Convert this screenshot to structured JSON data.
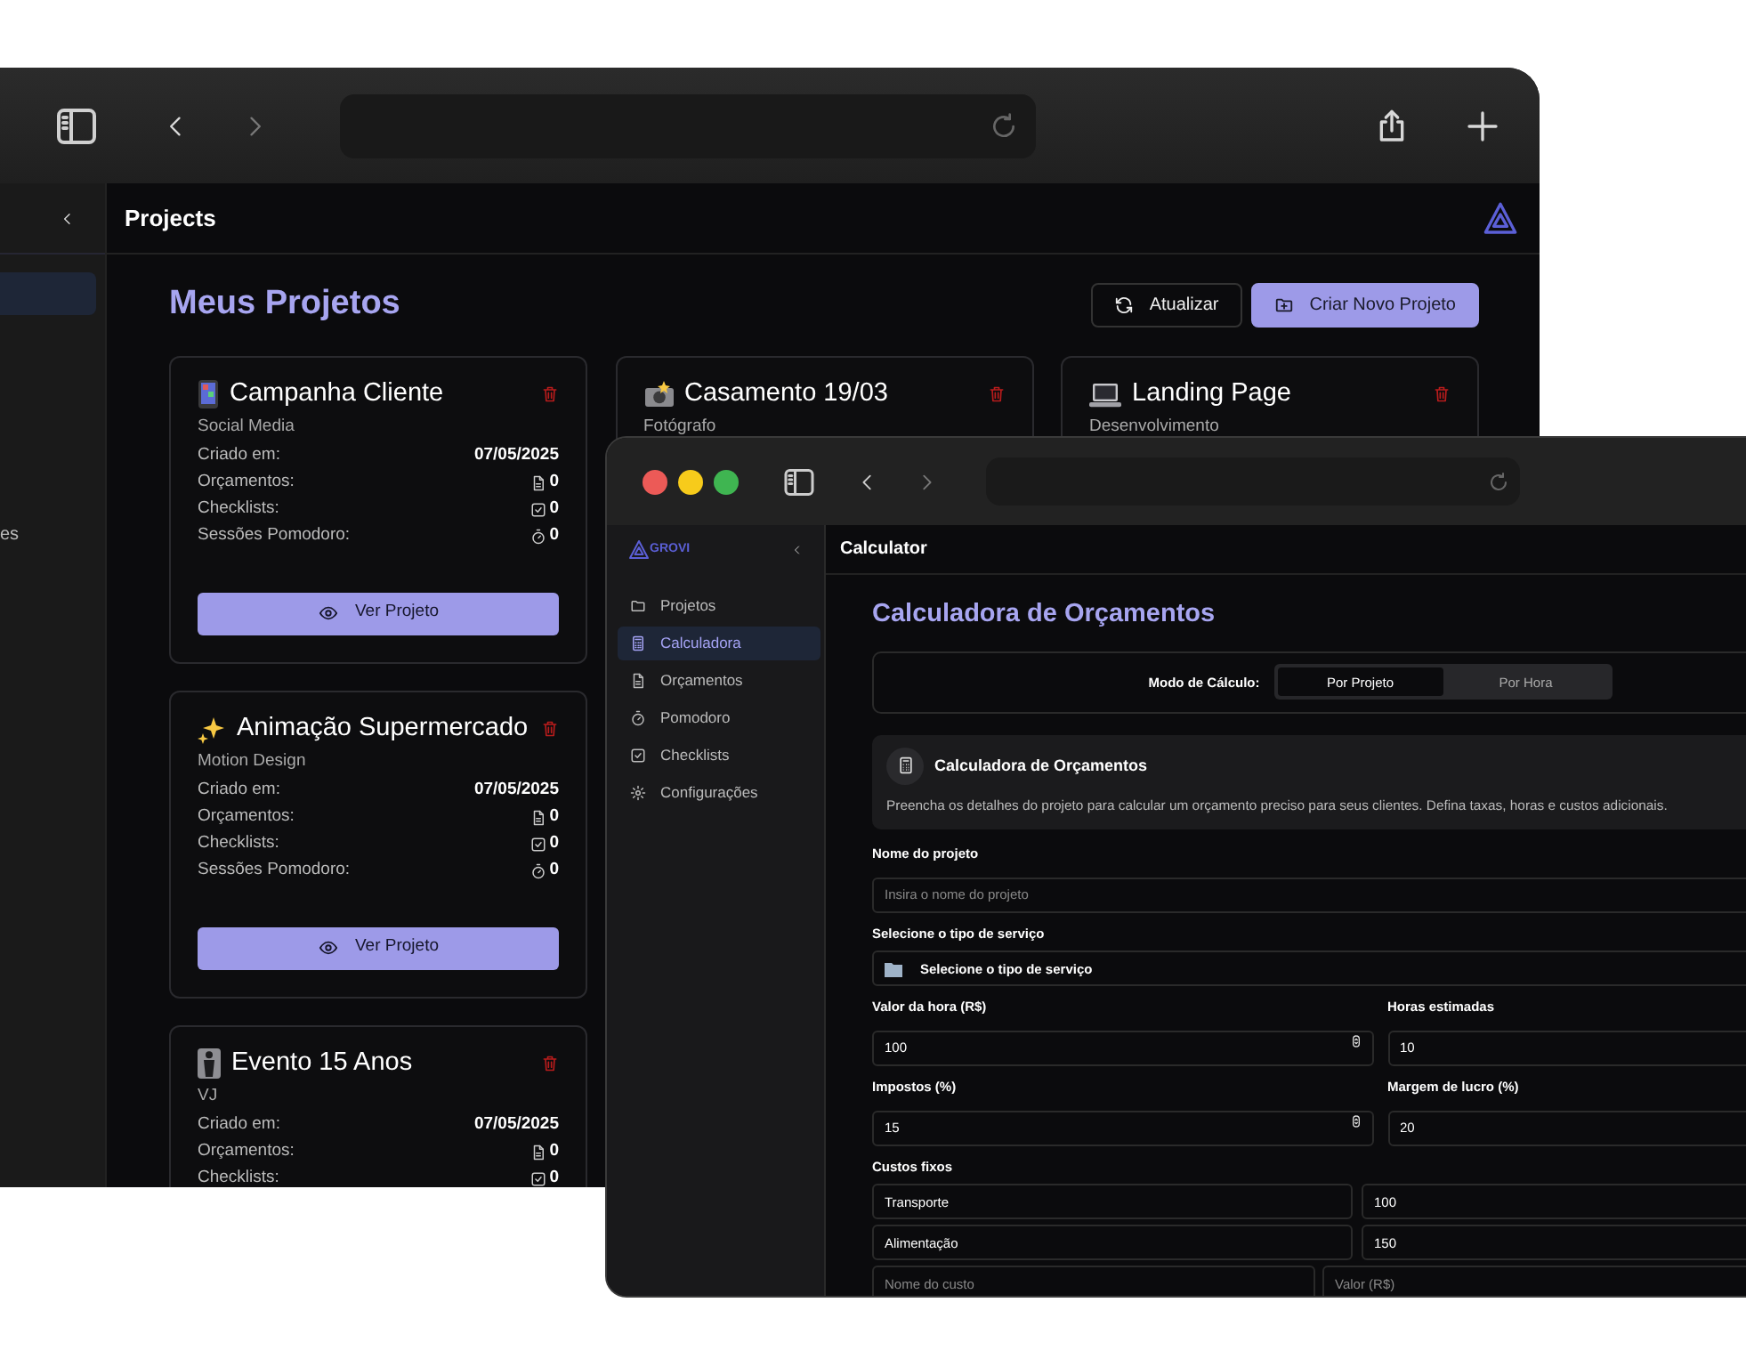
{
  "back_window": {
    "sidebar": {
      "items": [
        {
          "selected": true
        },
        {
          "label": "es",
          "selected": false
        }
      ]
    },
    "header_title": "Projects",
    "page_title": "Meus Projetos",
    "buttons": [
      {
        "label": "Atualizar",
        "kind": "refresh"
      },
      {
        "label": "Criar Novo Projeto",
        "kind": "create"
      }
    ],
    "projects": [
      {
        "kind": "phone",
        "title": "Campanha Cliente",
        "category": "Social Media",
        "stats": [
          {
            "kind": "date",
            "label": "Criado em:",
            "value": "07/05/2025"
          },
          {
            "kind": "budgets",
            "label": "Orçamentos:",
            "value": "0"
          },
          {
            "kind": "checklists",
            "label": "Checklists:",
            "value": "0"
          },
          {
            "kind": "pomodoro",
            "label": "Sessões Pomodoro:",
            "value": "0"
          }
        ],
        "action": "Ver Projeto"
      },
      {
        "kind": "camera",
        "title": "Casamento 19/03",
        "category": "Fotógrafo"
      },
      {
        "kind": "laptop",
        "title": "Landing Page",
        "category": "Desenvolvimento"
      },
      {
        "kind": "sparkles",
        "title": "Animação Supermercado",
        "category": "Motion Design",
        "stats": [
          {
            "kind": "date",
            "label": "Criado em:",
            "value": "07/05/2025"
          },
          {
            "kind": "budgets",
            "label": "Orçamentos:",
            "value": "0"
          },
          {
            "kind": "checklists",
            "label": "Checklists:",
            "value": "0"
          },
          {
            "kind": "pomodoro",
            "label": "Sessões Pomodoro:",
            "value": "0"
          }
        ],
        "action": "Ver Projeto"
      },
      {
        "kind": "figure",
        "title": "Evento 15 Anos",
        "category": "VJ",
        "stats": [
          {
            "kind": "date",
            "label": "Criado em:",
            "value": "07/05/2025"
          },
          {
            "kind": "budgets",
            "label": "Orçamentos:",
            "value": "0"
          },
          {
            "kind": "checklists",
            "label": "Checklists:",
            "value": "0"
          }
        ]
      }
    ]
  },
  "front_window": {
    "brand": "GROVI",
    "nav": [
      {
        "kind": "folder",
        "label": "Projetos",
        "selected": false
      },
      {
        "kind": "calculator",
        "label": "Calculadora",
        "selected": true
      },
      {
        "kind": "document",
        "label": "Orçamentos",
        "selected": false
      },
      {
        "kind": "timer",
        "label": "Pomodoro",
        "selected": false
      },
      {
        "kind": "checklist",
        "label": "Checklists",
        "selected": false
      },
      {
        "kind": "gear",
        "label": "Configurações",
        "selected": false
      }
    ],
    "header_title": "Calculator",
    "page_title": "Calculadora de Orçamentos",
    "mode": {
      "label": "Modo de Cálculo:",
      "options": [
        {
          "label": "Por Projeto",
          "selected": true
        },
        {
          "label": "Por Hora",
          "selected": false
        }
      ]
    },
    "info": {
      "title": "Calculadora de Orçamentos",
      "text": "Preencha os detalhes do projeto para calcular um orçamento preciso para seus clientes. Defina taxas, horas e custos adicionais."
    },
    "form_rows": [
      {
        "fields": [
          {
            "kind": "text",
            "label": "Nome do projeto",
            "placeholder": "Insira o nome do projeto"
          }
        ]
      },
      {
        "fields": [
          {
            "kind": "select",
            "label": "Selecione o tipo de serviço",
            "value": "Selecione o tipo de serviço"
          }
        ]
      },
      {
        "fields": [
          {
            "kind": "number",
            "label": "Valor da hora (R$)",
            "value": "100"
          },
          {
            "kind": "text",
            "label": "Horas estimadas",
            "value": "10"
          }
        ]
      },
      {
        "fields": [
          {
            "kind": "number",
            "label": "Impostos (%)",
            "value": "15"
          },
          {
            "kind": "text",
            "label": "Margem de lucro (%)",
            "value": "20"
          }
        ]
      }
    ],
    "fixed_costs": {
      "label": "Custos fixos",
      "items": [
        {
          "name": "Transporte",
          "value": "100"
        },
        {
          "name": "Alimentação",
          "value": "150"
        }
      ],
      "new_item": {
        "name_placeholder": "Nome do custo",
        "value_placeholder": "Valor (R$)"
      }
    }
  }
}
